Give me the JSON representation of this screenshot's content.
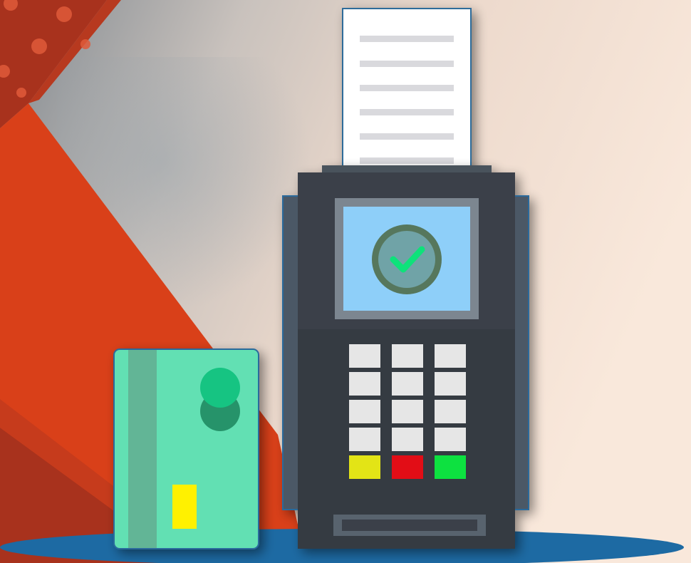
{
  "scene": {
    "title": "",
    "colors": {
      "background_light": "#f6e2d4",
      "background_gray": "#8b949b",
      "stripe_orange": "#d94019",
      "stripe_dark_red": "#a8321d",
      "floor_shadow": "#1d6aa3",
      "terminal_body": "#3a4048",
      "terminal_side": "#424b55",
      "screen_frame": "#7c8690",
      "screen": "#8ecff9",
      "check_circle": "#57775d",
      "check_mark": "#10e27a",
      "key": "#e6e6e6",
      "key_yellow": "#e3e414",
      "key_red": "#e20f12",
      "key_green": "#0fe13f",
      "receipt": "#ffffff",
      "receipt_line": "#d9d9dd",
      "card": "#62e0b3",
      "card_stripe": "#62b596",
      "card_dot_dark": "#28936a",
      "card_dot_light": "#13c482",
      "card_chip": "#fff100"
    },
    "icons": [
      "payment-terminal-icon",
      "receipt-icon",
      "check-mark-icon",
      "credit-card-icon"
    ],
    "keypad": {
      "number_keys": 12,
      "function_keys": [
        "yellow",
        "red",
        "green"
      ]
    },
    "receipt_lines": 6
  }
}
